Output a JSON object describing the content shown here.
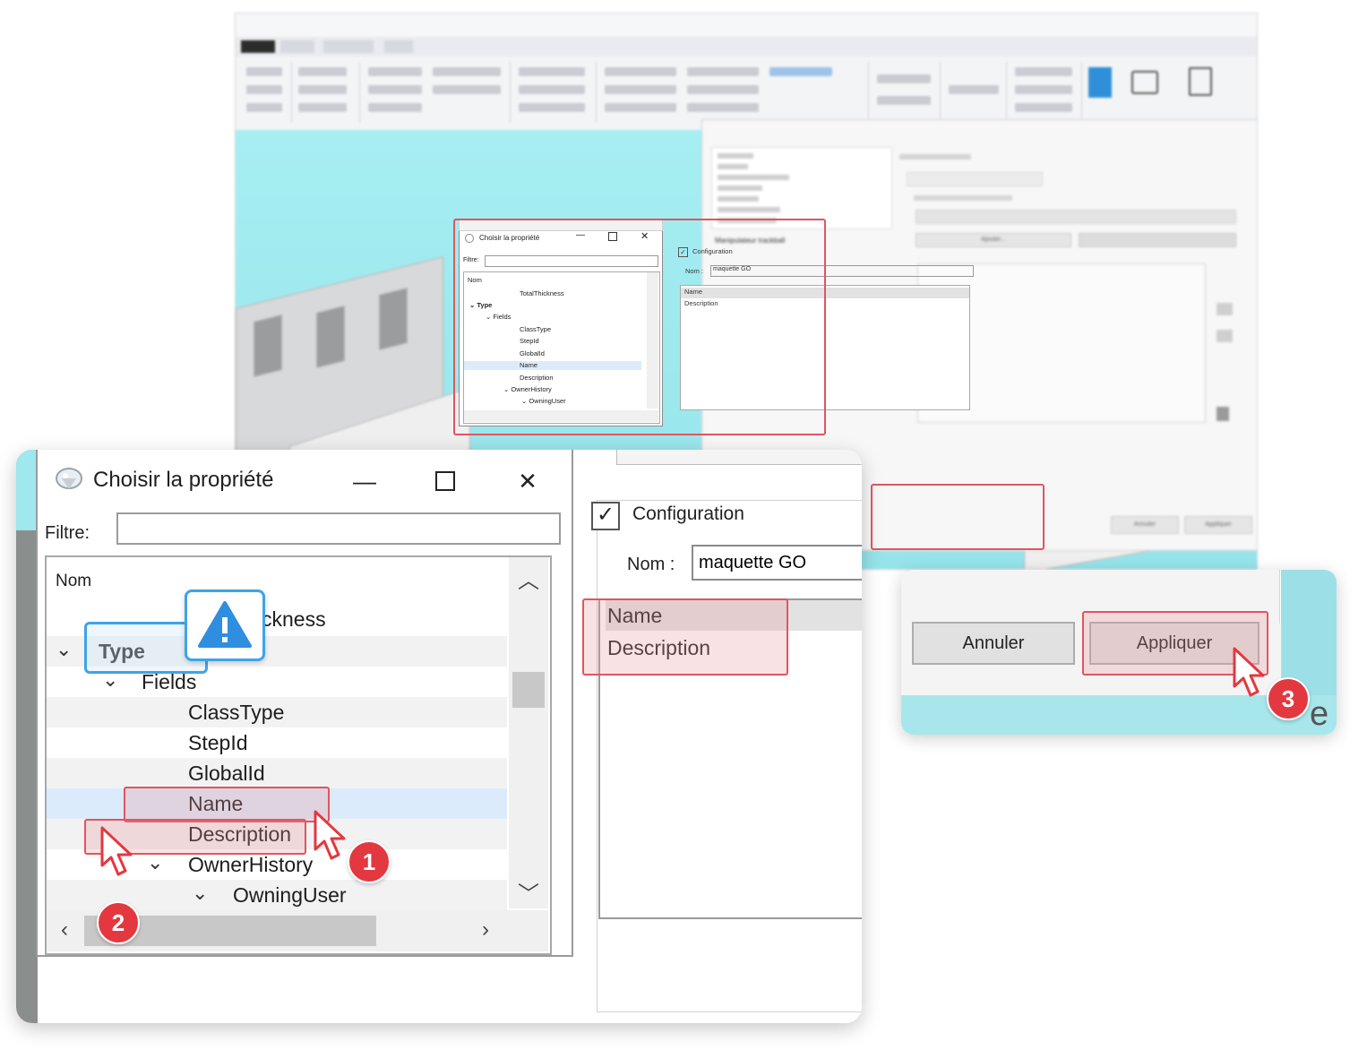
{
  "mini_dialog": {
    "title": "Choisir la propriété",
    "filter_label": "Filtre:",
    "column_header": "Nom",
    "rows": [
      "TotalThickness",
      "Type",
      "Fields",
      "ClassType",
      "StepId",
      "GlobalId",
      "Name",
      "Description",
      "OwnerHistory",
      "OwningUser"
    ],
    "config_label": "Configuration",
    "nom_label": "Nom :",
    "nom_value": "maquette GO",
    "list_items": [
      "Name",
      "Description"
    ],
    "ajouter": "Ajouter...",
    "annuler": "Annuler",
    "appliquer": "Appliquer",
    "sidebar_item": "Manipulateur trackball"
  },
  "chooser": {
    "title": "Choisir la propriété",
    "filter_label": "Filtre:",
    "filter_value": "",
    "column_header": "Nom",
    "partial_row": "ckness",
    "rows": {
      "type": "Type",
      "fields": "Fields",
      "classtype": "ClassType",
      "stepid": "StepId",
      "globalid": "GlobalId",
      "name": "Name",
      "description": "Description",
      "ownerhistory": "OwnerHistory",
      "owninguser": "OwningUser"
    }
  },
  "config": {
    "checkbox_label": "Configuration",
    "checked": true,
    "nom_label": "Nom :",
    "nom_value": "maquette GO",
    "items": [
      "Name",
      "Description"
    ]
  },
  "buttons": {
    "annuler": "Annuler",
    "appliquer": "Appliquer"
  },
  "callouts": {
    "step1": "1",
    "step2": "2",
    "step3": "3"
  },
  "colors": {
    "highlight_red": "#e05561",
    "badge_red": "#e3383f",
    "callout_blue": "#3ea4e9",
    "viewport_cyan": "#a6eef2"
  }
}
